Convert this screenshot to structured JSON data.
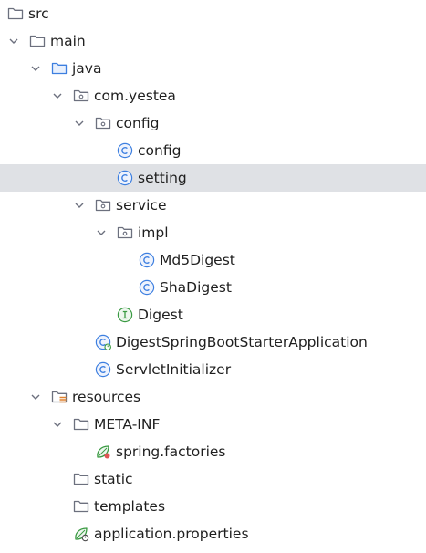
{
  "project_tree": {
    "nodes": [
      {
        "label": "src",
        "kind": "folder",
        "expanded": true
      },
      {
        "label": "main",
        "kind": "folder",
        "expanded": true
      },
      {
        "label": "java",
        "kind": "source-folder",
        "expanded": true
      },
      {
        "label": "com.yestea",
        "kind": "package",
        "expanded": true
      },
      {
        "label": "config",
        "kind": "package",
        "expanded": true
      },
      {
        "label": "config",
        "kind": "class"
      },
      {
        "label": "setting",
        "kind": "class",
        "selected": true
      },
      {
        "label": "service",
        "kind": "package",
        "expanded": true
      },
      {
        "label": "impl",
        "kind": "package",
        "expanded": true
      },
      {
        "label": "Md5Digest",
        "kind": "class"
      },
      {
        "label": "ShaDigest",
        "kind": "class"
      },
      {
        "label": "Digest",
        "kind": "interface"
      },
      {
        "label": "DigestSpringBootStarterApplication",
        "kind": "spring-boot-class"
      },
      {
        "label": "ServletInitializer",
        "kind": "class"
      },
      {
        "label": "resources",
        "kind": "resources-folder",
        "expanded": true
      },
      {
        "label": "META-INF",
        "kind": "folder",
        "expanded": true
      },
      {
        "label": "spring.factories",
        "kind": "spring-factories-file"
      },
      {
        "label": "static",
        "kind": "folder"
      },
      {
        "label": "templates",
        "kind": "folder"
      },
      {
        "label": "application.properties",
        "kind": "spring-properties-file"
      }
    ]
  },
  "colors": {
    "selection": "#dfe1e5",
    "class_icon": "#3d7fe0",
    "interface_icon": "#3a9a42",
    "folder_outline": "#6c707e",
    "source_folder": "#3d7fe0",
    "spring_green": "#3a9a42",
    "resources_accent": "#e0822f",
    "chevron": "#6c707e"
  },
  "icons": {
    "chevron_down": "chevron-down-icon",
    "folder": "folder-icon",
    "source_folder": "source-folder-icon",
    "package": "package-icon",
    "class": "class-icon",
    "interface": "interface-icon",
    "spring_boot_class": "spring-boot-class-icon",
    "resources_folder": "resources-folder-icon",
    "spring_factories": "spring-factories-icon",
    "spring_properties": "spring-properties-icon"
  }
}
